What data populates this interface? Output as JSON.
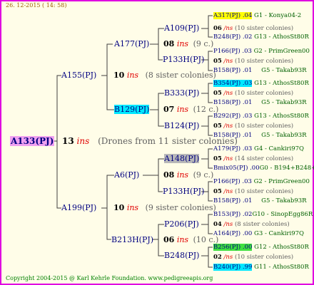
{
  "timestamp": "26. 12-2015 ( 14: 58)",
  "footer": "Copyright 2004-2015 @ Karl Kehrle Foundation.   www.pedigreeapis.org",
  "root": {
    "label": "A133(PJ)",
    "count": "13",
    "ins": "ins",
    "note": "(Drones from 11 sister colonies)"
  },
  "gen1": [
    {
      "label": "A155(PJ)",
      "count": "10",
      "ins": "ins",
      "note": "(8 sister colonies)"
    },
    {
      "label": "A199(PJ)",
      "count": "10",
      "ins": "ins",
      "note": "(9 sister colonies)"
    }
  ],
  "gen2": [
    {
      "label": "A177(PJ)",
      "count": "08",
      "ins": "ins",
      "note": "(9 c.)"
    },
    {
      "label": "B129(PJ)",
      "count": "07",
      "ins": "ins",
      "note": "(12 c.)"
    },
    {
      "label": "A6(PJ)",
      "count": "08",
      "ins": "ins",
      "note": "(9 c.)"
    },
    {
      "label": "B213H(PJ)",
      "count": "06",
      "ins": "ins",
      "note": "(10 c.)"
    }
  ],
  "gen3": [
    {
      "label": "A109(PJ)",
      "count": "06",
      "ins": "/ns",
      "note": "(10 sister colonies)"
    },
    {
      "label": "P133H(PJ)",
      "count": "05",
      "ins": "/ns",
      "note": "(10 sister colonies)"
    },
    {
      "label": "B333(PJ)",
      "count": "05",
      "ins": "/ns",
      "note": "(10 sister colonies)"
    },
    {
      "label": "B124(PJ)",
      "count": "05",
      "ins": "/ns",
      "note": "(10 sister colonies)"
    },
    {
      "label": "A148(PJ)",
      "count": "05",
      "ins": "/ns",
      "note": "(14 sister colonies)"
    },
    {
      "label": "P133H(PJ)",
      "count": "05",
      "ins": "/ns",
      "note": "(10 sister colonies)"
    },
    {
      "label": "P206(PJ)",
      "count": "04",
      "ins": "/ns",
      "note": "(8 sister colonies)"
    },
    {
      "label": "B248(PJ)",
      "count": "02",
      "ins": "/ns",
      "note": "(10 sister colonies)"
    }
  ],
  "gen4": [
    {
      "label": "A317(PJ) .04",
      "origin": "G1 - Konya04-2"
    },
    {
      "label": "B248(PJ) .02",
      "origin": "G13 - AthosSt80R"
    },
    {
      "label": "P166(PJ) .03",
      "origin": "G2 - PrimGreen00"
    },
    {
      "label": "B158(PJ) .01",
      "origin": "G5 - Takab93R"
    },
    {
      "label": "B354(PJ) .03",
      "origin": "G13 - AthosSt80R"
    },
    {
      "label": "B158(PJ) .01",
      "origin": "G5 - Takab93R"
    },
    {
      "label": "B292(PJ) .03",
      "origin": "G13 - AthosSt80R"
    },
    {
      "label": "B158(PJ) .01",
      "origin": "G5 - Takab93R"
    },
    {
      "label": "A179(PJ) .03",
      "origin": "G4 - Cankiri97Q"
    },
    {
      "label": "Bmix05(PJ) .00",
      "origin": "G0 - B194+B248+B"
    },
    {
      "label": "P166(PJ) .03",
      "origin": "G2 - PrimGreen00"
    },
    {
      "label": "B158(PJ) .01",
      "origin": "G5 - Takab93R"
    },
    {
      "label": "B153(PJ) .02",
      "origin": "G10 - SinopEgg86R"
    },
    {
      "label": "A164(PJ) .00",
      "origin": "G3 - Cankiri97Q"
    },
    {
      "label": "B256(PJ) .00",
      "origin": "G12 - AthosSt80R"
    },
    {
      "label": "B240(PJ) .99",
      "origin": "G11 - AthosSt80R"
    }
  ],
  "colors": {
    "border": "#e000e0",
    "root_bg": "#f0a0f0",
    "highlight_cyan": "#00e8ff",
    "highlight_yellow": "#ffff00",
    "highlight_green": "#40e040",
    "highlight_grey": "#b8b8b8",
    "ins_red": "#e00000"
  }
}
